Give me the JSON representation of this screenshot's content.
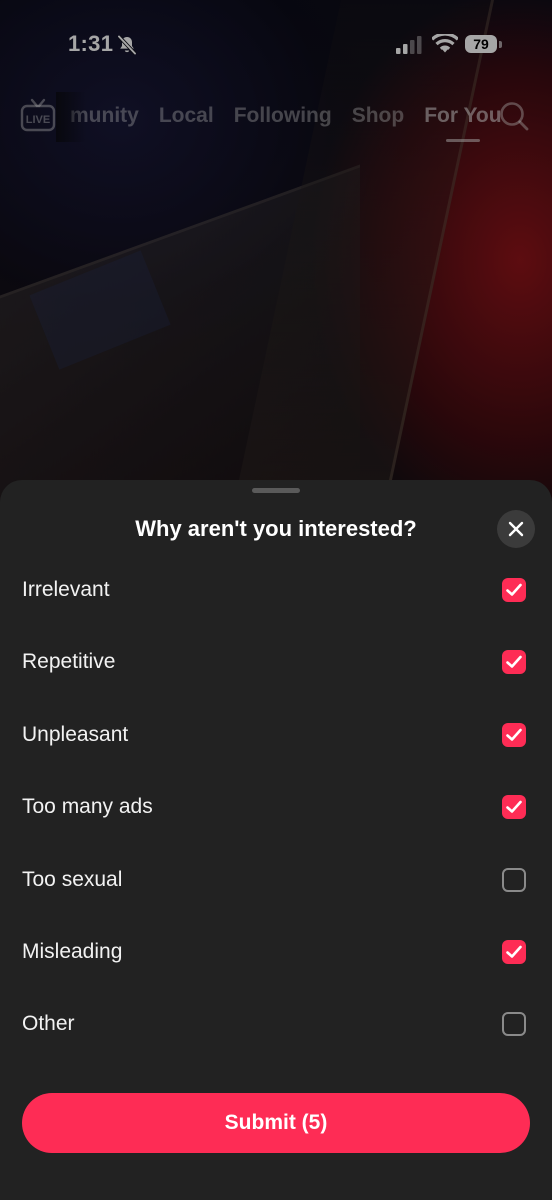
{
  "status_bar": {
    "time": "1:31",
    "battery": "79"
  },
  "nav": {
    "live_label": "LIVE",
    "tabs": [
      {
        "label": "munity",
        "active": false
      },
      {
        "label": "Local",
        "active": false
      },
      {
        "label": "Following",
        "active": false
      },
      {
        "label": "Shop",
        "active": false
      },
      {
        "label": "For You",
        "active": true
      }
    ]
  },
  "sheet": {
    "title": "Why aren't you interested?",
    "options": [
      {
        "label": "Irrelevant",
        "checked": true
      },
      {
        "label": "Repetitive",
        "checked": true
      },
      {
        "label": "Unpleasant",
        "checked": true
      },
      {
        "label": "Too many ads",
        "checked": true
      },
      {
        "label": "Too sexual",
        "checked": false
      },
      {
        "label": "Misleading",
        "checked": true
      },
      {
        "label": "Other",
        "checked": false
      }
    ],
    "submit_label": "Submit (5)"
  },
  "colors": {
    "accent": "#fe2c55",
    "sheet_background": "#222222"
  },
  "icons": {
    "bell": "bell-slash-icon",
    "signal": "cellular-signal-icon",
    "wifi": "wifi-icon",
    "live": "live-tv-icon",
    "search": "search-icon",
    "close": "close-icon",
    "check": "checkmark-icon"
  }
}
